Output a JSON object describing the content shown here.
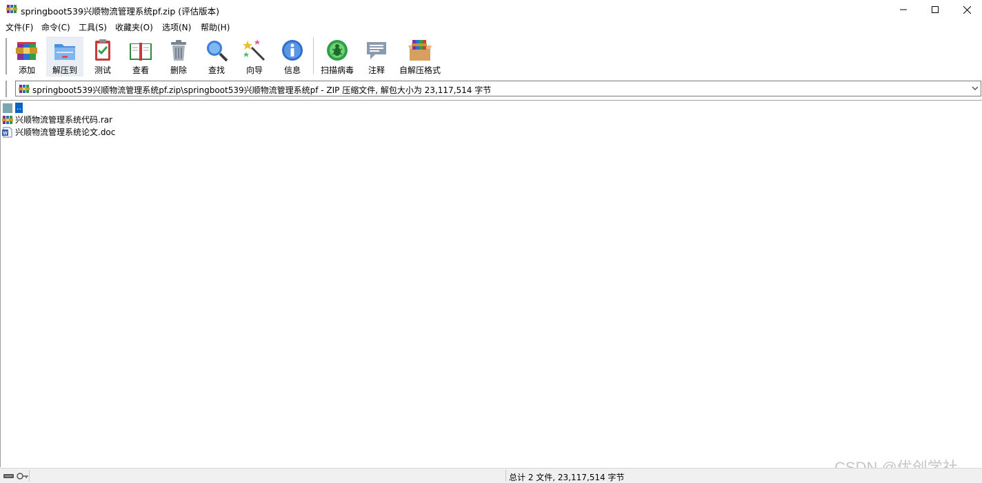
{
  "window": {
    "title": "springboot539兴顺物流管理系统pf.zip (评估版本)",
    "icon": "winrar-archive-icon"
  },
  "menu": [
    "文件(F)",
    "命令(C)",
    "工具(S)",
    "收藏夹(O)",
    "选项(N)",
    "帮助(H)"
  ],
  "toolbar": {
    "add": "添加",
    "extract": "解压到",
    "test": "测试",
    "view": "查看",
    "delete": "删除",
    "find": "查找",
    "wizard": "向导",
    "info": "信息",
    "scan": "扫描病毒",
    "comment": "注释",
    "sfx": "自解压格式"
  },
  "address": {
    "text": "springboot539兴顺物流管理系统pf.zip\\springboot539兴顺物流管理系统pf - ZIP 压缩文件, 解包大小为 23,117,514 字节"
  },
  "files": [
    {
      "name": "..",
      "icon": "parent-folder-icon"
    },
    {
      "name": "兴顺物流管理系统代码.rar",
      "icon": "rar-file-icon"
    },
    {
      "name": "兴顺物流管理系统论文.doc",
      "icon": "word-doc-icon"
    }
  ],
  "status": {
    "summary": "总计 2 文件, 23,117,514 字节"
  },
  "watermark": "CSDN @优创学社",
  "colors": {
    "selection": "#0a64c8",
    "statusbar": "#f0f0f0"
  }
}
